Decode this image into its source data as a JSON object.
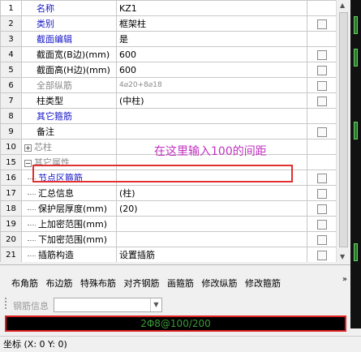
{
  "properties": [
    {
      "num": "1",
      "name": "名称",
      "value": "KZ1",
      "style": "blue",
      "check": false,
      "selected": true
    },
    {
      "num": "2",
      "name": "类别",
      "value": "框架柱",
      "style": "blue",
      "check": true
    },
    {
      "num": "3",
      "name": "截面编辑",
      "value": "是",
      "style": "blue",
      "check": false
    },
    {
      "num": "4",
      "name": "截面宽(B边)(mm)",
      "value": "600",
      "style": "black",
      "check": true
    },
    {
      "num": "5",
      "name": "截面高(H边)(mm)",
      "value": "600",
      "style": "black",
      "check": true
    },
    {
      "num": "6",
      "name": "全部纵筋",
      "value": "4⌀20+8⌀18",
      "style": "grey",
      "check": true
    },
    {
      "num": "7",
      "name": "柱类型",
      "value": "(中柱)",
      "style": "black",
      "check": true
    },
    {
      "num": "8",
      "name": "其它箍筋",
      "value": "",
      "style": "blue",
      "check": false
    },
    {
      "num": "9",
      "name": "备注",
      "value": "",
      "style": "black",
      "check": true
    },
    {
      "num": "10",
      "name": "芯柱",
      "value": "",
      "style": "grey",
      "check": false,
      "expander": "+"
    },
    {
      "num": "15",
      "name": "其它属性",
      "value": "",
      "style": "grey",
      "check": false,
      "expander": "−"
    },
    {
      "num": "16",
      "name": "节点区箍筋",
      "value": "",
      "style": "blue",
      "check": true,
      "indent": true
    },
    {
      "num": "17",
      "name": "汇总信息",
      "value": "(柱)",
      "style": "black",
      "check": true,
      "indent": true
    },
    {
      "num": "18",
      "name": "保护层厚度(mm)",
      "value": "(20)",
      "style": "black",
      "check": true,
      "indent": true
    },
    {
      "num": "19",
      "name": "上加密范围(mm)",
      "value": "",
      "style": "black",
      "check": true,
      "indent": true
    },
    {
      "num": "20",
      "name": "下加密范围(mm)",
      "value": "",
      "style": "black",
      "check": true,
      "indent": true
    },
    {
      "num": "21",
      "name": "插筋构造",
      "value": "设置插筋",
      "style": "black",
      "check": true,
      "indent": true
    }
  ],
  "annotation": "在这里输入100的间距",
  "toolbar": {
    "buttons": [
      "布角筋",
      "布边筋",
      "特殊布筋",
      "对齐钢筋",
      "画箍筋",
      "修改纵筋",
      "修改箍筋"
    ],
    "more": "»"
  },
  "rebar_info": {
    "label": "钢筋信息",
    "value": ""
  },
  "input_bar": {
    "text": "2Φ8@100/200"
  },
  "status": {
    "text": "坐标 (X: 0 Y: 0)"
  }
}
